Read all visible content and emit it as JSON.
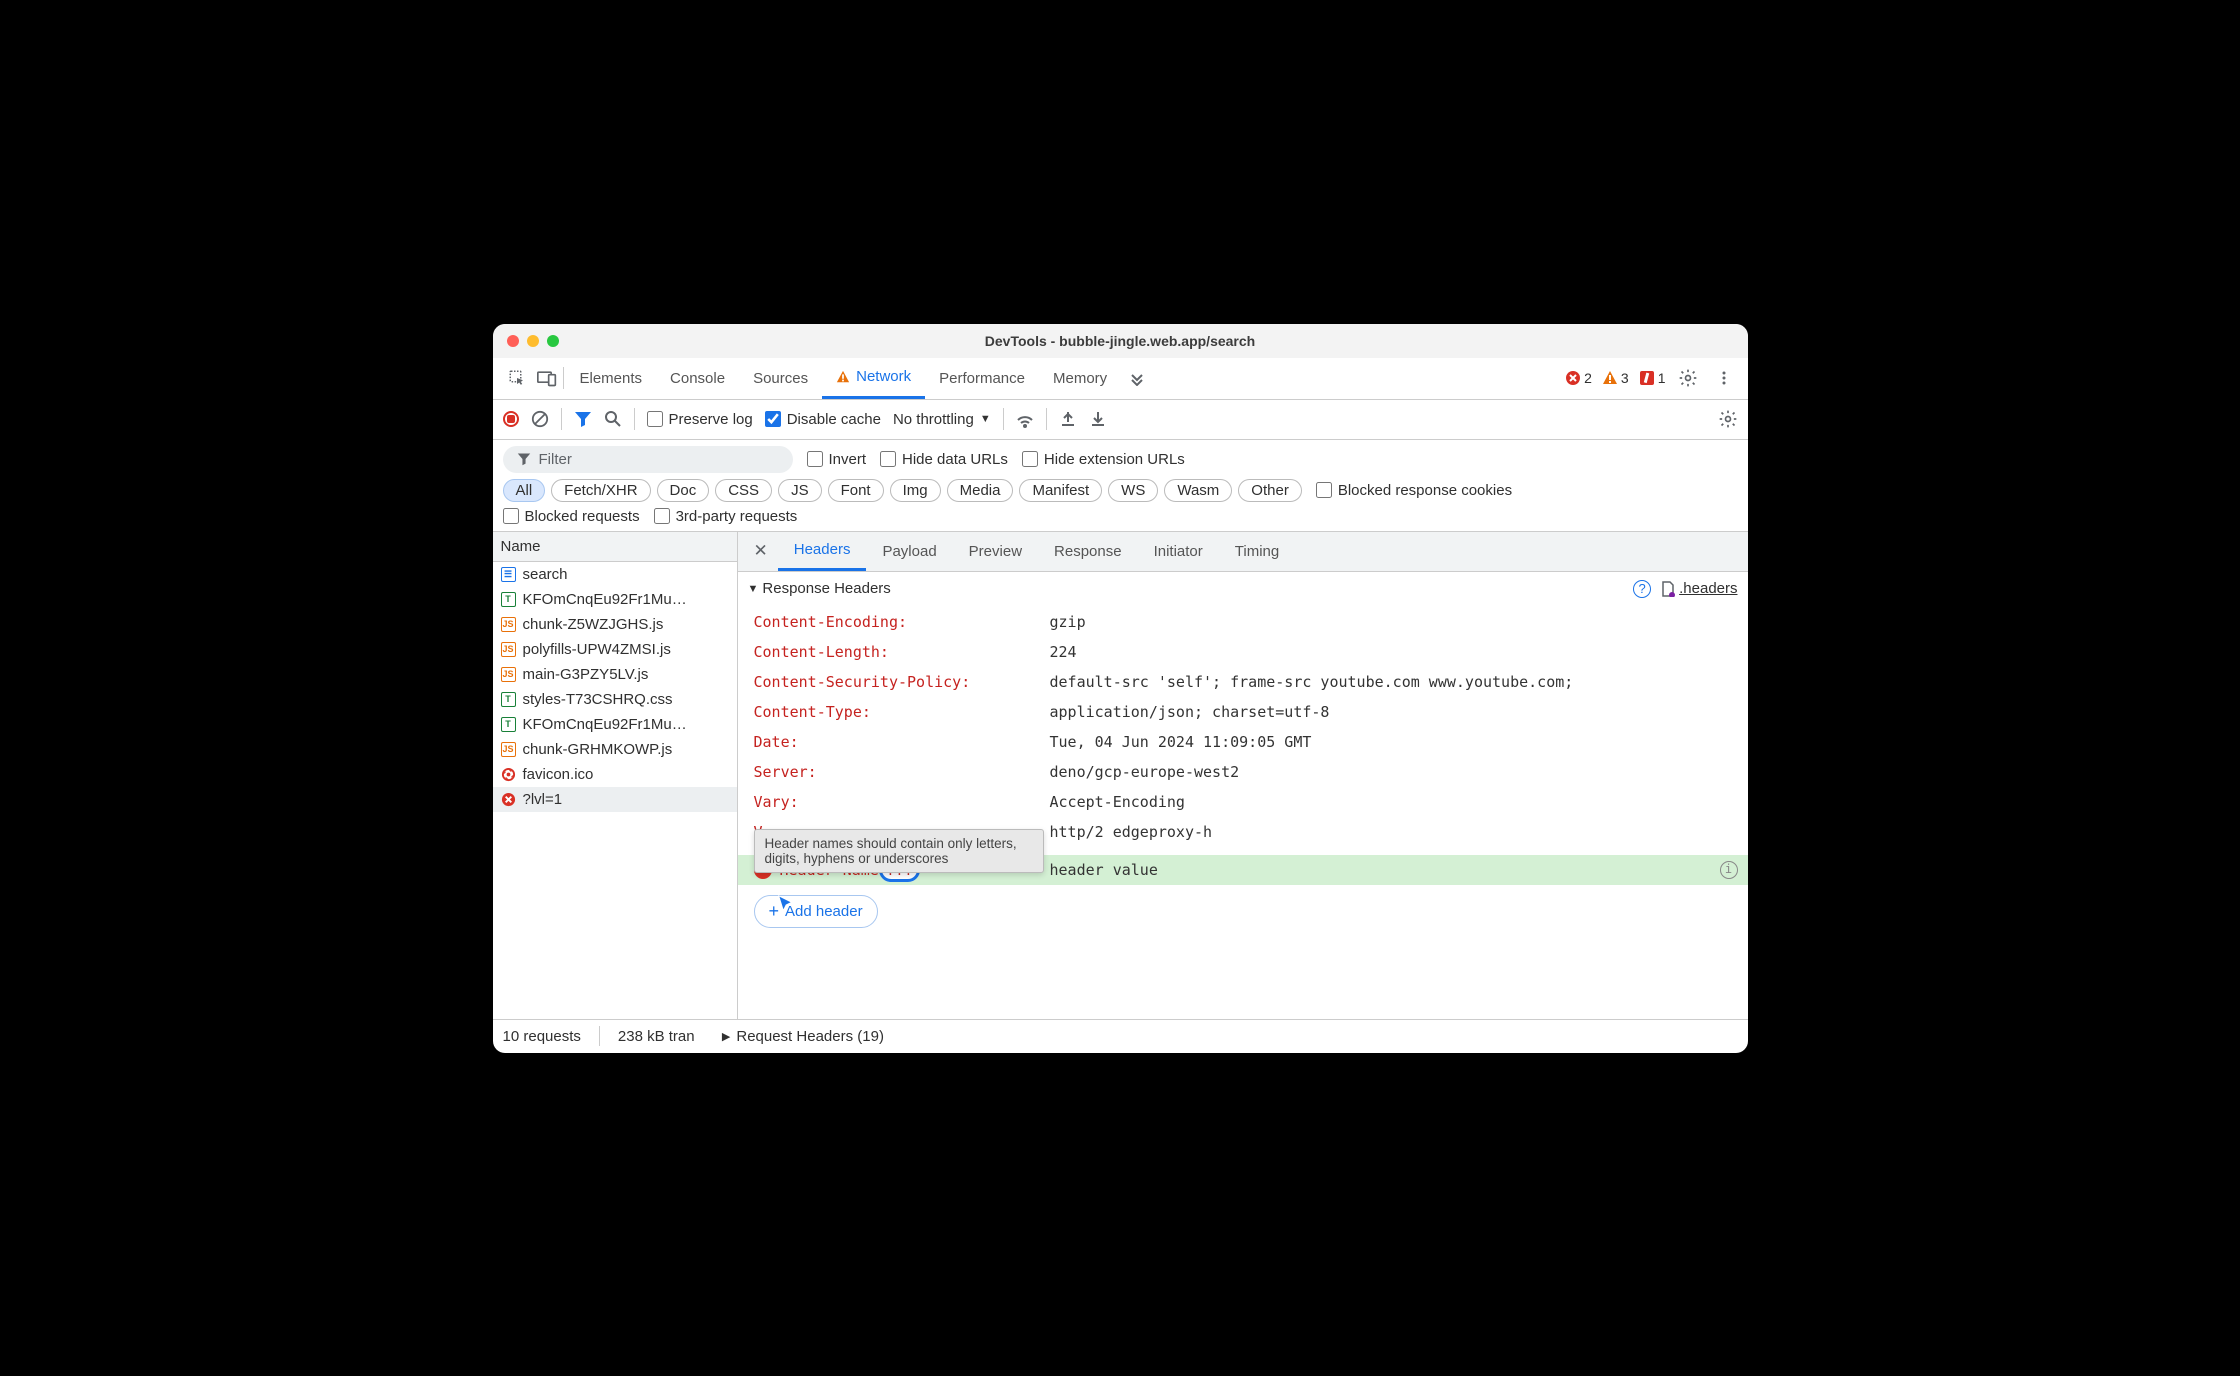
{
  "window_title": "DevTools - bubble-jingle.web.app/search",
  "main_tabs": [
    "Elements",
    "Console",
    "Sources",
    "Network",
    "Performance",
    "Memory"
  ],
  "main_tabs_active": "Network",
  "counter_errors": "2",
  "counter_warnings": "3",
  "counter_issues": "1",
  "toolbar": {
    "preserve": "Preserve log",
    "disable": "Disable cache",
    "throttle": "No throttling"
  },
  "filter": {
    "placeholder": "Filter",
    "invert": "Invert",
    "hide_data": "Hide data URLs",
    "hide_ext": "Hide extension URLs",
    "blocked_cookies": "Blocked response cookies",
    "blocked_req": "Blocked requests",
    "third_party": "3rd-party requests"
  },
  "pills": [
    "All",
    "Fetch/XHR",
    "Doc",
    "CSS",
    "JS",
    "Font",
    "Img",
    "Media",
    "Manifest",
    "WS",
    "Wasm",
    "Other"
  ],
  "pills_active": "All",
  "sidebar_header": "Name",
  "requests": [
    {
      "icon": "doc",
      "name": "search"
    },
    {
      "icon": "font",
      "name": "KFOmCnqEu92Fr1Mu…"
    },
    {
      "icon": "js",
      "name": "chunk-Z5WZJGHS.js"
    },
    {
      "icon": "js",
      "name": "polyfills-UPW4ZMSI.js"
    },
    {
      "icon": "js",
      "name": "main-G3PZY5LV.js"
    },
    {
      "icon": "font",
      "name": "styles-T73CSHRQ.css"
    },
    {
      "icon": "font",
      "name": "KFOmCnqEu92Fr1Mu…"
    },
    {
      "icon": "js",
      "name": "chunk-GRHMKOWP.js"
    },
    {
      "icon": "fav",
      "name": "favicon.ico"
    },
    {
      "icon": "err",
      "name": "?lvl=1"
    }
  ],
  "selected_request": 9,
  "detail_tabs": [
    "Headers",
    "Payload",
    "Preview",
    "Response",
    "Initiator",
    "Timing"
  ],
  "detail_tab_active": "Headers",
  "section_title": "Response Headers",
  "headers_file": ".headers",
  "response_headers": [
    {
      "n": "Content-Encoding:",
      "v": "gzip"
    },
    {
      "n": "Content-Length:",
      "v": "224"
    },
    {
      "n": "Content-Security-Policy:",
      "v": "default-src 'self'; frame-src youtube.com www.youtube.com;"
    },
    {
      "n": "Content-Type:",
      "v": "application/json; charset=utf-8"
    },
    {
      "n": "Date:",
      "v": "Tue, 04 Jun 2024 11:09:05 GMT"
    },
    {
      "n": "Server:",
      "v": "deno/gcp-europe-west2"
    },
    {
      "n": "Vary:",
      "v": "Accept-Encoding"
    },
    {
      "n": "Via:",
      "v": "http/2 edgeproxy-h"
    }
  ],
  "custom_header": {
    "name": "Header-Name",
    "suffix": "!!!",
    "value": "header value"
  },
  "add_header_label": "Add header",
  "tooltip": "Header names should contain only letters, digits, hyphens or underscores",
  "status": {
    "requests": "10 requests",
    "transfer": "238 kB tran",
    "section": "Request Headers (19)"
  }
}
